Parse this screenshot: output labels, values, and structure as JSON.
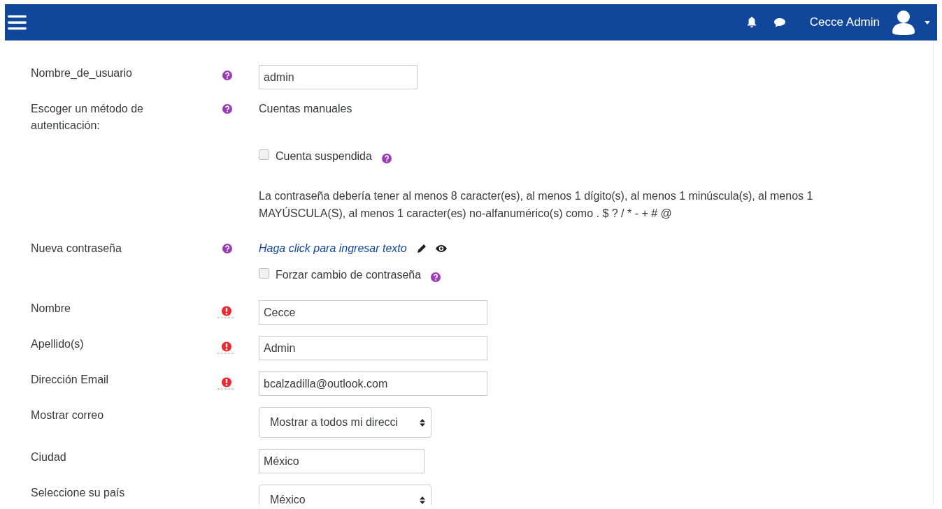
{
  "navbar": {
    "user_name": "Cecce Admin"
  },
  "form": {
    "rows": [
      {
        "kind": "text",
        "label": "Nombre_de_usuario",
        "help": true,
        "value": "admin"
      },
      {
        "kind": "static",
        "label": "Escoger un método de autenticación:",
        "help": true,
        "value": "Cuentas manuales"
      },
      {
        "kind": "checkbox",
        "text": "Cuenta suspendida",
        "checked": false,
        "help": true
      },
      {
        "kind": "note",
        "text": "La contraseña debería tener al menos 8 caracter(es), al menos 1 dígito(s), al menos 1 minúscula(s), al menos 1 MAYÚSCULA(S), al menos 1 caracter(es) no-alfanumérico(s) como . $ ? / * - + # @"
      },
      {
        "kind": "editable",
        "label": "Nueva contraseña",
        "help": true,
        "value": "Haga click para ingresar texto"
      },
      {
        "kind": "checkbox",
        "text": "Forzar cambio de contraseña",
        "checked": false,
        "help": true
      },
      {
        "kind": "text",
        "label": "Nombre",
        "required": true,
        "value": "Cecce"
      },
      {
        "kind": "text",
        "label": "Apellido(s)",
        "required": true,
        "value": "Admin"
      },
      {
        "kind": "text",
        "label": "Dirección Email",
        "required": true,
        "value": "bcalzadilla@outlook.com"
      },
      {
        "kind": "select",
        "label": "Mostrar correo",
        "value": "Mostrar a todos mi direcci"
      },
      {
        "kind": "text",
        "label": "Ciudad",
        "value": "México"
      },
      {
        "kind": "select",
        "label": "Seleccione su país",
        "value": "México"
      }
    ]
  }
}
